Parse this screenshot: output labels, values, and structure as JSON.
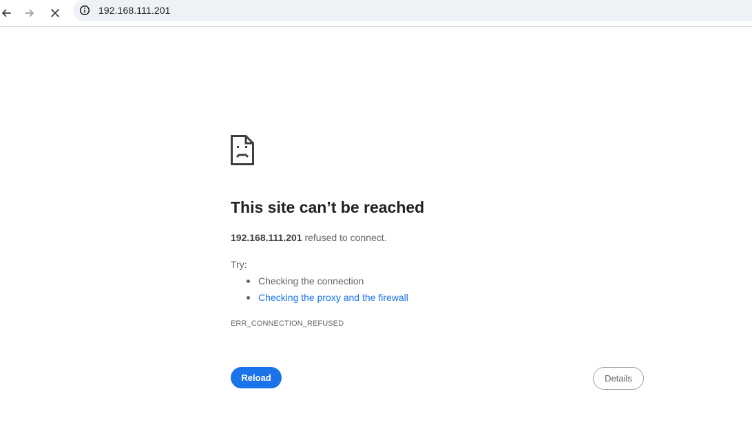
{
  "browser": {
    "url": "192.168.111.201",
    "icons": {
      "back": "arrow-left-icon",
      "forward": "arrow-right-icon",
      "stop": "close-icon",
      "site_info": "info-icon"
    }
  },
  "error": {
    "icon": "sad-page-icon",
    "title": "This site can’t be reached",
    "host": "192.168.111.201",
    "message": " refused to connect.",
    "try_label": "Try:",
    "suggestions": [
      {
        "text": "Checking the connection",
        "is_link": false
      },
      {
        "text": "Checking the proxy and the firewall",
        "is_link": true
      }
    ],
    "code": "ERR_CONNECTION_REFUSED"
  },
  "buttons": {
    "reload_label": "Reload",
    "details_label": "Details"
  },
  "colors": {
    "accent": "#1a73e8",
    "text_primary": "#202124",
    "text_secondary": "#5f6368",
    "omnibox_bg": "#eef1f6"
  }
}
